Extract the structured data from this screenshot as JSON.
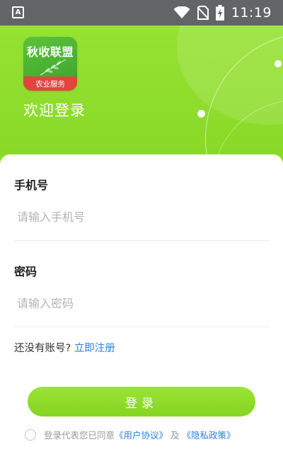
{
  "status_bar": {
    "time": "11:19",
    "left_icon_letter": "A"
  },
  "header": {
    "logo_title": "秋收联盟",
    "logo_subtitle": "农业服务",
    "welcome": "欢迎登录"
  },
  "form": {
    "phone": {
      "label": "手机号",
      "placeholder": "请输入手机号",
      "value": ""
    },
    "password": {
      "label": "密码",
      "placeholder": "请输入密码",
      "value": ""
    },
    "register_prompt": "还没有账号?",
    "register_link": "立即注册",
    "login_button": "登录",
    "agreement": {
      "checked": false,
      "prefix": "登录代表您已同意",
      "user_agreement": "《用户协议》",
      "and": "及",
      "privacy_policy": "《隐私政策》"
    }
  },
  "colors": {
    "brand_green": "#8edb2a",
    "link_blue": "#2b80de",
    "logo_red": "#e0463e"
  },
  "icons": [
    "app-notification-icon",
    "wifi-icon",
    "no-sim-icon",
    "battery-charging-icon"
  ]
}
